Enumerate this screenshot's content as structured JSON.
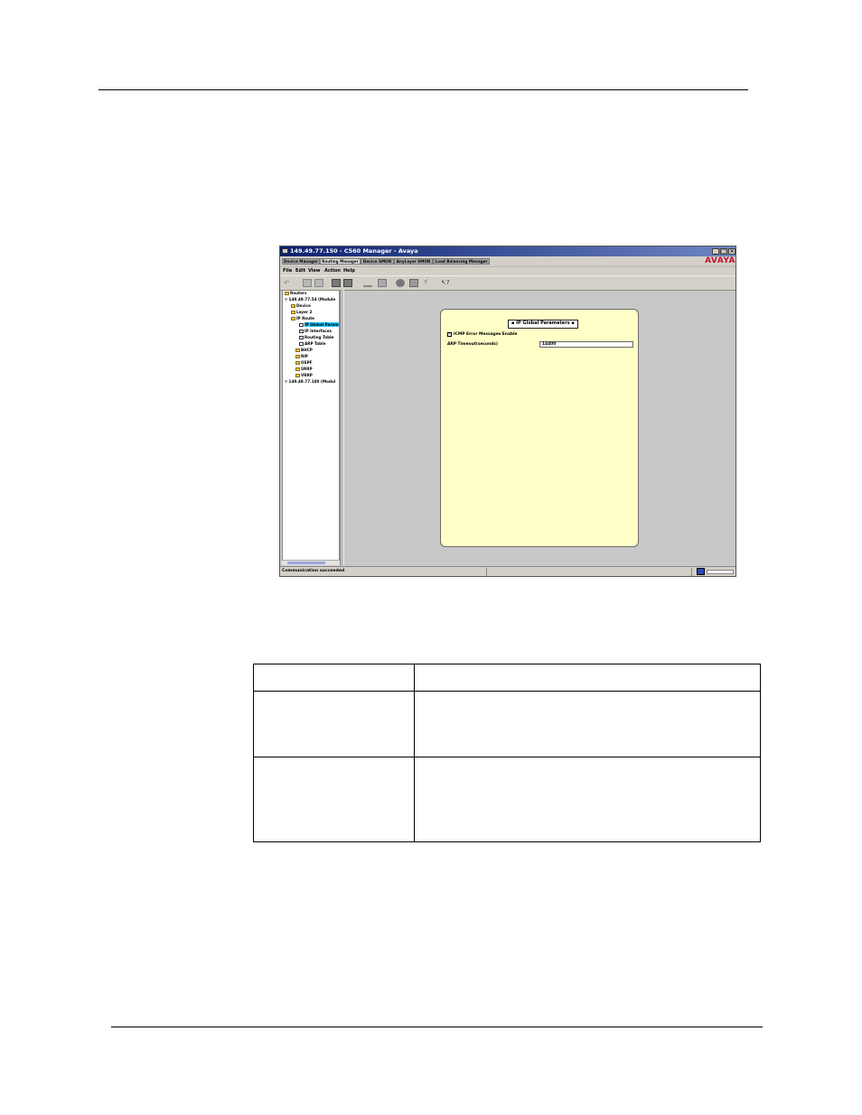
{
  "window": {
    "title": "149.49.77.150 - C560 Manager - Avaya",
    "min_glyph": "_",
    "max_glyph": "□",
    "close_glyph": "×",
    "logo": "AVAYA"
  },
  "tabs": [
    {
      "label": "Device Manager"
    },
    {
      "label": "Routing Manager"
    },
    {
      "label": "Device SMON"
    },
    {
      "label": "AnyLayer SMON"
    },
    {
      "label": "Load Balancing Manager"
    }
  ],
  "menu": [
    "File",
    "Edit",
    "View",
    "Action",
    "Help"
  ],
  "tree": {
    "items": [
      {
        "label": "Routers"
      },
      {
        "label": "149.49.77.54 (Module"
      },
      {
        "label": "Device"
      },
      {
        "label": "Layer 2"
      },
      {
        "label": "IP Route"
      },
      {
        "label": "IP Global Param"
      },
      {
        "label": "IP Interfaces"
      },
      {
        "label": "Routing Table"
      },
      {
        "label": "ARP Table"
      },
      {
        "label": "BHCP"
      },
      {
        "label": "RIP"
      },
      {
        "label": "OSPF"
      },
      {
        "label": "SRRP"
      },
      {
        "label": "VRRP"
      },
      {
        "label": "149.49.77.100 (Modul"
      }
    ]
  },
  "panel": {
    "title": "IP Global Parameters",
    "checkbox_label": "ICMP Error Messages Enable",
    "checkbox_mark": "✓",
    "arp_label": "ARP Timeout(seconds)",
    "arp_value": "14400"
  },
  "status": {
    "text": "Communication succeeded"
  }
}
